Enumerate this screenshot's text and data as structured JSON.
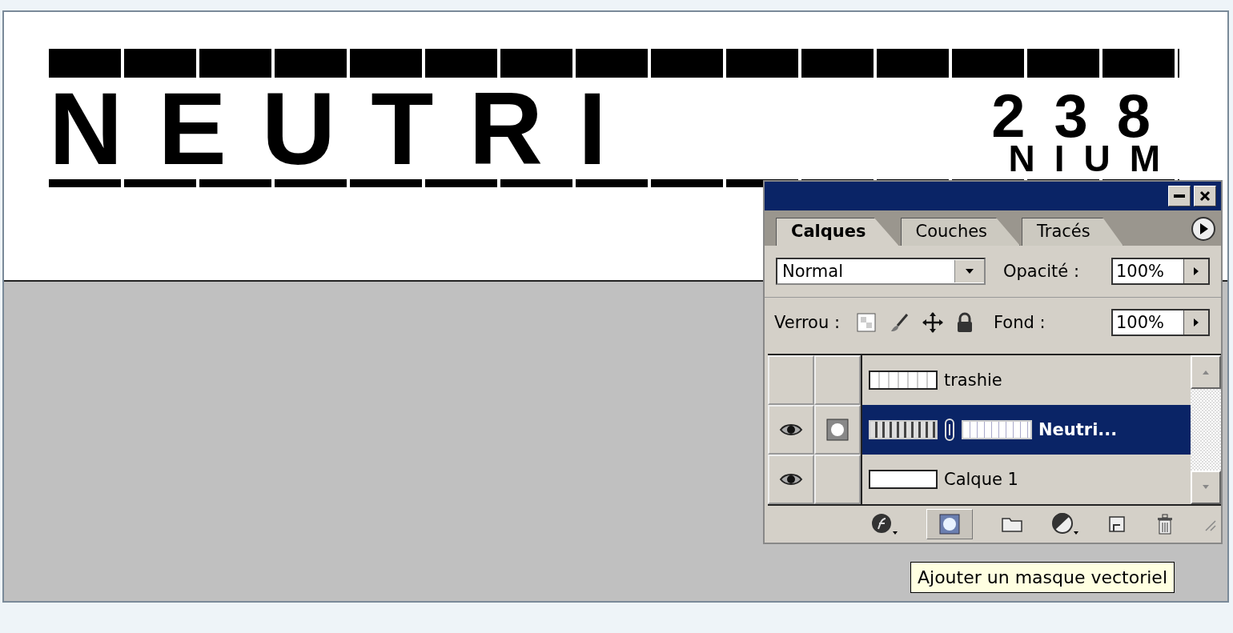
{
  "artwork": {
    "main": "NEUTRI",
    "number": "238",
    "suffix": "NIUM"
  },
  "panel": {
    "tabs": [
      {
        "label": "Calques",
        "selected": true
      },
      {
        "label": "Couches",
        "selected": false
      },
      {
        "label": "Tracés",
        "selected": false
      }
    ],
    "blend_mode": "Normal",
    "opacity_label": "Opacité :",
    "opacity": "100%",
    "lock_label": "Verrou :",
    "fill_label": "Fond :",
    "fill": "100%",
    "layers": [
      {
        "name": "trashie",
        "visible": false,
        "selected": false,
        "kind": "pattern",
        "has_mask": false
      },
      {
        "name": "Neutri...",
        "visible": true,
        "selected": true,
        "kind": "masked",
        "has_mask": true
      },
      {
        "name": "Calque 1",
        "visible": true,
        "selected": false,
        "kind": "plain",
        "has_mask": false
      }
    ]
  },
  "tooltip": "Ajouter un masque vectoriel"
}
